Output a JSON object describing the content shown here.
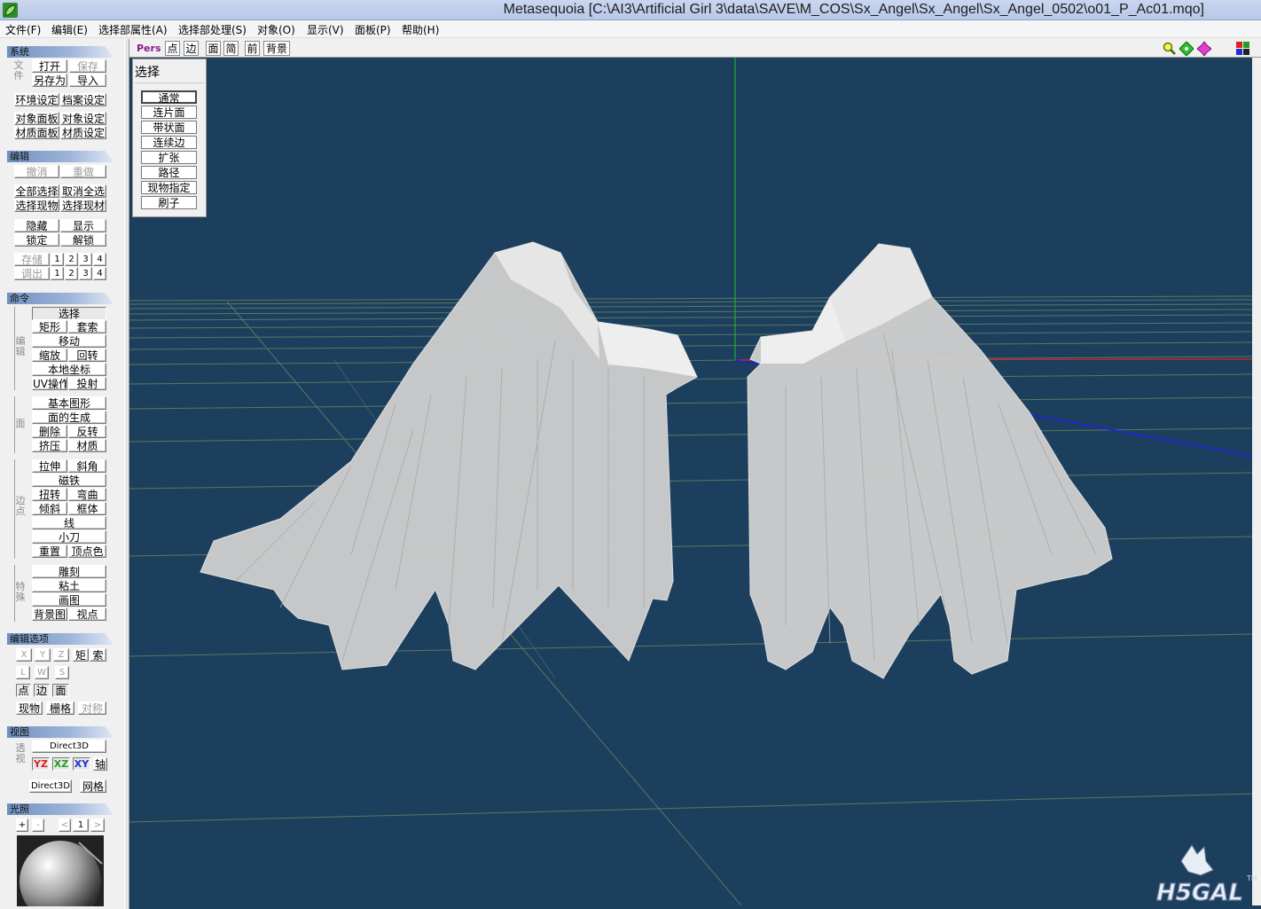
{
  "window": {
    "title": "Metasequoia [C:\\AI3\\Artificial Girl 3\\data\\SAVE\\M_COS\\Sx_Angel\\Sx_Angel\\Sx_Angel_0502\\o01_P_Ac01.mqo]"
  },
  "menu": [
    "文件(F)",
    "编辑(E)",
    "选择部属性(A)",
    "选择部处理(S)",
    "对象(O)",
    "显示(V)",
    "面板(P)",
    "帮助(H)"
  ],
  "left": {
    "system": {
      "header": "系统",
      "group_label": "文件",
      "open": "打开",
      "save": "保存",
      "save_as": "另存为",
      "import": "导入",
      "env_settings": "环境设定",
      "file_settings": "档案设定",
      "object_panel": "对象面板",
      "object_settings": "对象设定",
      "material_panel": "材质面板",
      "material_settings": "材质设定"
    },
    "edit": {
      "header": "编辑",
      "undo": "撤消",
      "redo": "重做",
      "select_all": "全部选择",
      "deselect_all": "取消全选",
      "select_current_object": "选择现物",
      "select_current_material": "选择现材",
      "hide": "隐藏",
      "show": "显示",
      "lock": "锁定",
      "unlock": "解锁",
      "store": "存储",
      "recall": "调出",
      "slots": [
        "1",
        "2",
        "3",
        "4"
      ]
    },
    "command": {
      "header": "命令",
      "edit_group": "编辑",
      "select": "选择",
      "rect": "矩形",
      "lasso": "套索",
      "move": "移动",
      "scale": "缩放",
      "rotate": "回转",
      "local_coord": "本地坐标",
      "uv": "UV操作",
      "project": "投射",
      "face_group": "面",
      "primitive": "基本图形",
      "create_face": "面的生成",
      "delete": "删除",
      "flip": "反转",
      "extrude": "挤压",
      "material": "材质",
      "edge_group": "边点",
      "stretch": "拉伸",
      "bevel": "斜角",
      "magnet": "磁铁",
      "twist": "扭转",
      "bend": "弯曲",
      "lean": "倾斜",
      "lattice": "框体",
      "line": "线",
      "knife": "小刀",
      "weld": "重置",
      "vertex_color": "顶点色",
      "special_group": "特殊",
      "sculpt": "雕刻",
      "clay": "粘土",
      "paint": "画图",
      "background_image": "背景图",
      "viewpoint": "视点"
    },
    "edit_options": {
      "header": "编辑选项",
      "x": "X",
      "y": "Y",
      "z": "Z",
      "rect": "矩",
      "lasso": "索",
      "l": "L",
      "w": "W",
      "s": "S",
      "vertex": "点",
      "edge": "边",
      "face": "面",
      "current_object": "现物",
      "grid": "栅格",
      "symmetry": "对称"
    },
    "view": {
      "header": "视图",
      "group_label": "透视",
      "renderer": "Direct3D",
      "yz": "YZ",
      "xz": "XZ",
      "xy": "XY",
      "axis": "轴",
      "renderer2": "Direct3D",
      "grid": "网格"
    },
    "light": {
      "header": "光照",
      "plus": "+",
      "minus": "-",
      "prev": "<",
      "index": "1",
      "next": ">"
    }
  },
  "viewport": {
    "mode": "Pers",
    "tabs": [
      "点",
      "边",
      "面",
      "简",
      "前",
      "背景"
    ],
    "select_panel": {
      "title": "选择",
      "items": [
        "通常",
        "连片面",
        "带状面",
        "连续边",
        "扩张",
        "路径",
        "现物指定",
        "刷子"
      ],
      "active": "通常"
    },
    "toolbar_icons": [
      "zoom-icon",
      "pan-icon",
      "rotate-icon",
      "view-switch-icon"
    ],
    "logo_text": "H5GAL",
    "logo_tm": "TM"
  },
  "colors": {
    "viewport_bg": "#1d3f5e",
    "axis_x": "#e02020",
    "axis_y": "#20c020",
    "axis_z": "#2020e0",
    "grid": "#6f8a5e",
    "wing": "#d8d8d8"
  }
}
